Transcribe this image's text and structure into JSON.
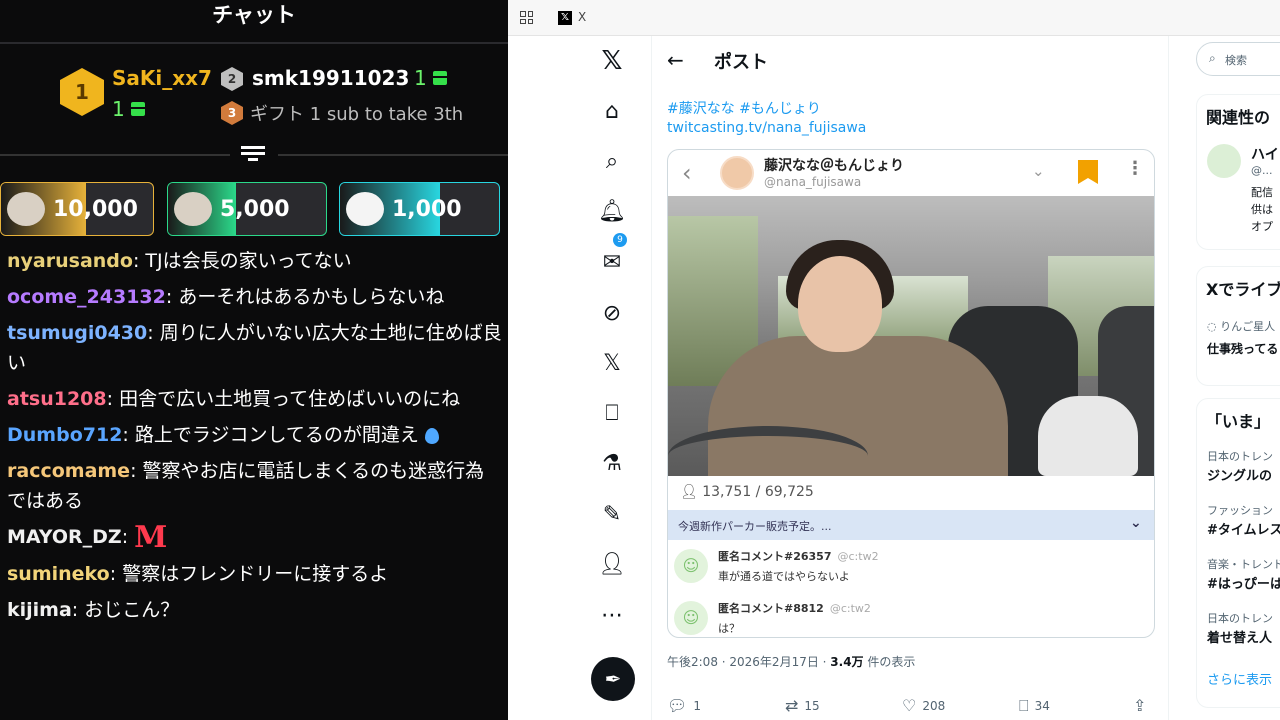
{
  "chat": {
    "title": "チャット",
    "top_gifters": {
      "first": {
        "rank": "1",
        "name": "SaKi_xx7",
        "count": "1"
      },
      "second": {
        "rank": "2",
        "name": "smk19911023",
        "count": "1"
      },
      "third": {
        "rank": "3",
        "text": "ギフト 1 sub to take 3th"
      }
    },
    "tiers": [
      {
        "value": "10,000",
        "color": "#e7b23a"
      },
      {
        "value": "5,000",
        "color": "#2bd98a"
      },
      {
        "value": "1,000",
        "color": "#28d6e0"
      }
    ],
    "messages": [
      {
        "user": "nyarusando",
        "color": "#e8d07a",
        "text": "TJは会長の家いってない"
      },
      {
        "user": "ocome_243132",
        "color": "#b67bff",
        "text": "あーそれはあるかもしらないね"
      },
      {
        "user": "tsumugi0430",
        "color": "#7db3ff",
        "text": "周りに人がいない広大な土地に住めば良い"
      },
      {
        "user": "atsu1208",
        "color": "#ff6f8a",
        "text": "田舎で広い土地買って住めばいいのにね"
      },
      {
        "user": "Dumbo712",
        "color": "#5aa5ff",
        "text": "路上でラジコンしてるのが間違え"
      },
      {
        "user": "raccomame",
        "color": "#f5c77a",
        "text": "警察やお店に電話しまくるのも迷惑行為ではある"
      },
      {
        "user": "MAYOR_DZ",
        "color": "#f0f0f0",
        "text": "M"
      },
      {
        "user": "sumineko",
        "color": "#f2d47a",
        "text": "警察はフレンドリーに接するよ"
      },
      {
        "user": "kijima",
        "color": "#f0f0f0",
        "text": "おじこん？"
      }
    ]
  },
  "browser": {
    "tab_title": "X",
    "notif_count": "9",
    "post": {
      "header": "ポスト",
      "hashtags": "#藤沢なな #もんじょり",
      "link": "twitcasting.tv/nana_fujisawa",
      "embed": {
        "name": "藤沢なな＠もんじょり",
        "handle": "@nana_fujisawa",
        "stats": "13,751 / 69,725",
        "banner": "今週新作パーカー販売予定。...",
        "comments": [
          {
            "name": "匿名コメント#26357",
            "src": "@c:tw2",
            "text": "車が通る道ではやらないよ"
          },
          {
            "name": "匿名コメント#8812",
            "src": "@c:tw2",
            "text": "は？"
          }
        ]
      },
      "time": "午後2:08 · 2026年2月17日 ·",
      "views": "3.4万",
      "views_label": "件の表示",
      "actions": {
        "reply": "1",
        "repost": "15",
        "like": "208",
        "bookmark": "34"
      }
    },
    "sidebar": {
      "search_placeholder": "検索",
      "related_title": "関連性の",
      "related_name": "ハイ",
      "related_handle": "@...",
      "related_bio": [
        "配信",
        "供は",
        "オプ"
      ],
      "live_title": "Xでライブ",
      "live_sub": "りんご星人",
      "live_text": "仕事残ってる",
      "now_title": "「いま」",
      "trends": [
        {
          "cat": "日本のトレン",
          "name": "ジングルの"
        },
        {
          "cat": "ファッション",
          "name": "#タイムレス"
        },
        {
          "cat": "音楽・トレンド",
          "name": "#はっぴーは"
        },
        {
          "cat": "日本のトレン",
          "name": "着せ替え人"
        }
      ],
      "more": "さらに表示"
    }
  }
}
